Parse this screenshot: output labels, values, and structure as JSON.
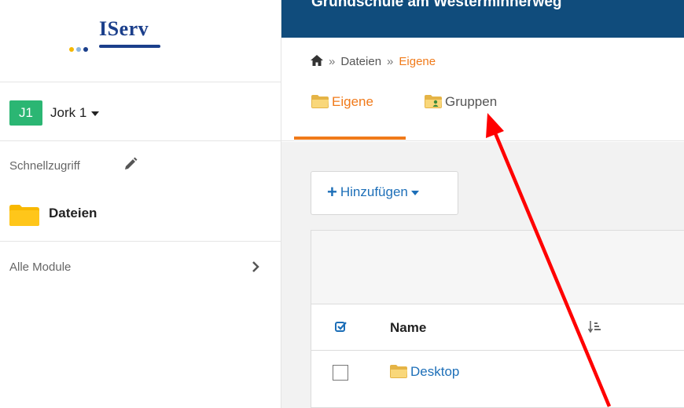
{
  "logo": {
    "text": "IServ"
  },
  "sidebar": {
    "user_initials": "J1",
    "user_name": "Jork 1",
    "quick_access_label": "Schnellzugriff",
    "files_label": "Dateien",
    "all_modules_label": "Alle Module"
  },
  "header": {
    "school_name": "Grundschule am Westerminnerweg"
  },
  "breadcrumb": {
    "sep": "»",
    "item1": "Dateien",
    "current": "Eigene"
  },
  "tabs": {
    "own": "Eigene",
    "groups": "Gruppen"
  },
  "toolbar": {
    "add_label": "Hinzufügen"
  },
  "table": {
    "col_name": "Name",
    "rows": [
      {
        "name": "Desktop"
      }
    ]
  },
  "colors": {
    "accent": "#f07a1a",
    "header_bg": "#104c7c",
    "link": "#1d6fb8",
    "avatar": "#2bb673",
    "annotation_arrow": "#ff0000"
  },
  "icons": [
    "home-icon",
    "folder-icon",
    "group-folder-icon",
    "pencil-icon",
    "chevron-right-icon",
    "checkbox-icon",
    "sort-icon",
    "plus-icon"
  ]
}
